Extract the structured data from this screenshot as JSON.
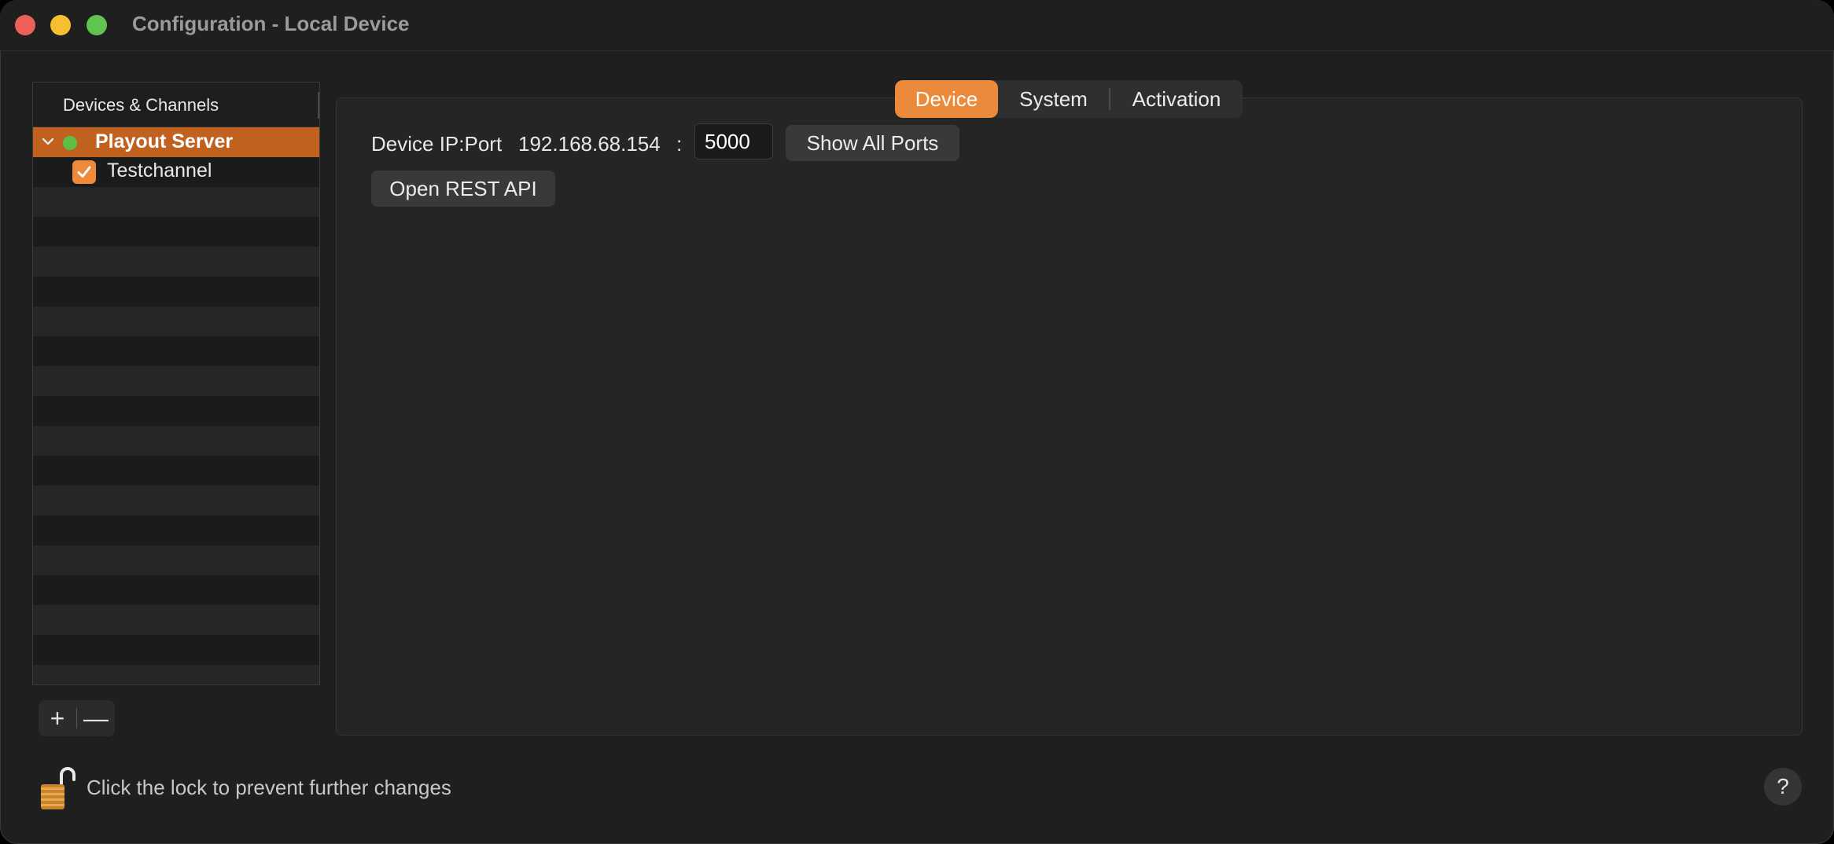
{
  "window": {
    "title": "Configuration - Local Device"
  },
  "sidebar": {
    "header": "Devices & Channels",
    "device": {
      "label": "Playout Server",
      "status_color": "#5cc048",
      "expanded": true
    },
    "channels": [
      {
        "label": "Testchannel",
        "checked": true
      }
    ]
  },
  "list_controls": {
    "add_label": "+",
    "remove_label": "—"
  },
  "tabs": [
    {
      "label": "Device",
      "active": true
    },
    {
      "label": "System",
      "active": false
    },
    {
      "label": "Activation",
      "active": false
    }
  ],
  "device_tab": {
    "ip_port_label": "Device IP:Port",
    "ip_value": "192.168.68.154",
    "separator": ":",
    "port_value": "5000",
    "show_all_ports_label": "Show All Ports",
    "open_rest_api_label": "Open REST API"
  },
  "footer": {
    "lock_text": "Click the lock to prevent further changes",
    "help_label": "?"
  },
  "colors": {
    "accent": "#ec8a3b",
    "selection": "#c1611f",
    "status_online": "#5cc048"
  },
  "icons": [
    "close-window",
    "minimize-window",
    "zoom-window",
    "chevron-down-icon",
    "checkmark-icon",
    "padlock-open-icon",
    "help-icon"
  ]
}
